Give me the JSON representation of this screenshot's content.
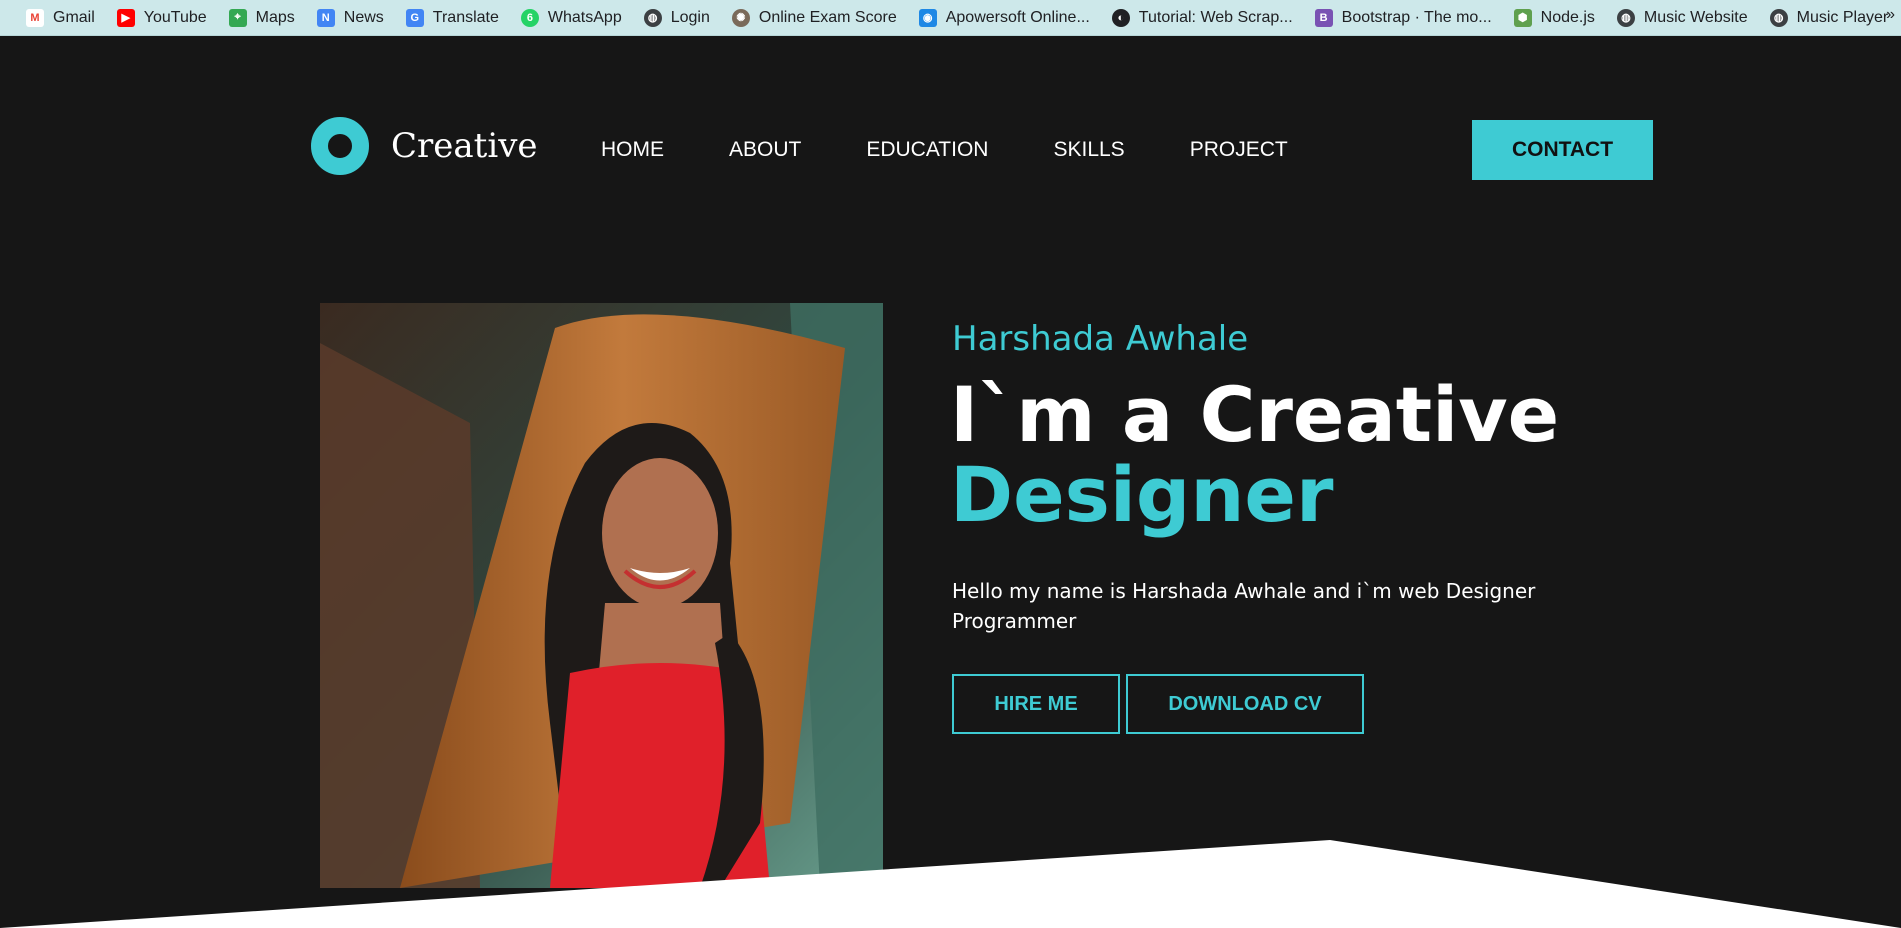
{
  "bookmarks": [
    {
      "label": "Gmail",
      "icon": "gmail-icon",
      "color": "#ea4335"
    },
    {
      "label": "YouTube",
      "icon": "youtube-icon",
      "color": "#ff0000"
    },
    {
      "label": "Maps",
      "icon": "maps-icon",
      "color": "#34a853"
    },
    {
      "label": "News",
      "icon": "news-icon",
      "color": "#4285f4"
    },
    {
      "label": "Translate",
      "icon": "translate-icon",
      "color": "#4285f4"
    },
    {
      "label": "WhatsApp",
      "icon": "whatsapp-icon",
      "color": "#25d366"
    },
    {
      "label": "Login",
      "icon": "globe-icon",
      "color": "#3c4043"
    },
    {
      "label": "Online Exam Score",
      "icon": "exam-icon",
      "color": "#7a6a5a"
    },
    {
      "label": "Apowersoft Online...",
      "icon": "apowersoft-icon",
      "color": "#1e88e5"
    },
    {
      "label": "Tutorial: Web Scrap...",
      "icon": "tutorial-icon",
      "color": "#202124"
    },
    {
      "label": "Bootstrap · The mo...",
      "icon": "bootstrap-icon",
      "color": "#7952b3"
    },
    {
      "label": "Node.js",
      "icon": "nodejs-icon",
      "color": "#5fa04e"
    },
    {
      "label": "Music Website",
      "icon": "globe-icon",
      "color": "#3c4043"
    },
    {
      "label": "Music Player",
      "icon": "globe-icon",
      "color": "#3c4043"
    }
  ],
  "bookmarks_more": "»",
  "header": {
    "logo_text": "Creative",
    "nav": [
      "HOME",
      "ABOUT",
      "EDUCATION",
      "SKILLS",
      "PROJECT"
    ],
    "contact_label": "CONTACT"
  },
  "hero": {
    "name": "Harshada Awhale",
    "title_line1": "I`m a Creative",
    "title_line2": "Designer",
    "description": "Hello my name is Harshada Awhale and i`m web Designer Programmer",
    "hire_label": "HIRE ME",
    "cv_label": "DOWNLOAD CV"
  },
  "colors": {
    "accent": "#3ecbd3",
    "background": "#161616",
    "bookmarks_bar": "#cde8ea"
  }
}
